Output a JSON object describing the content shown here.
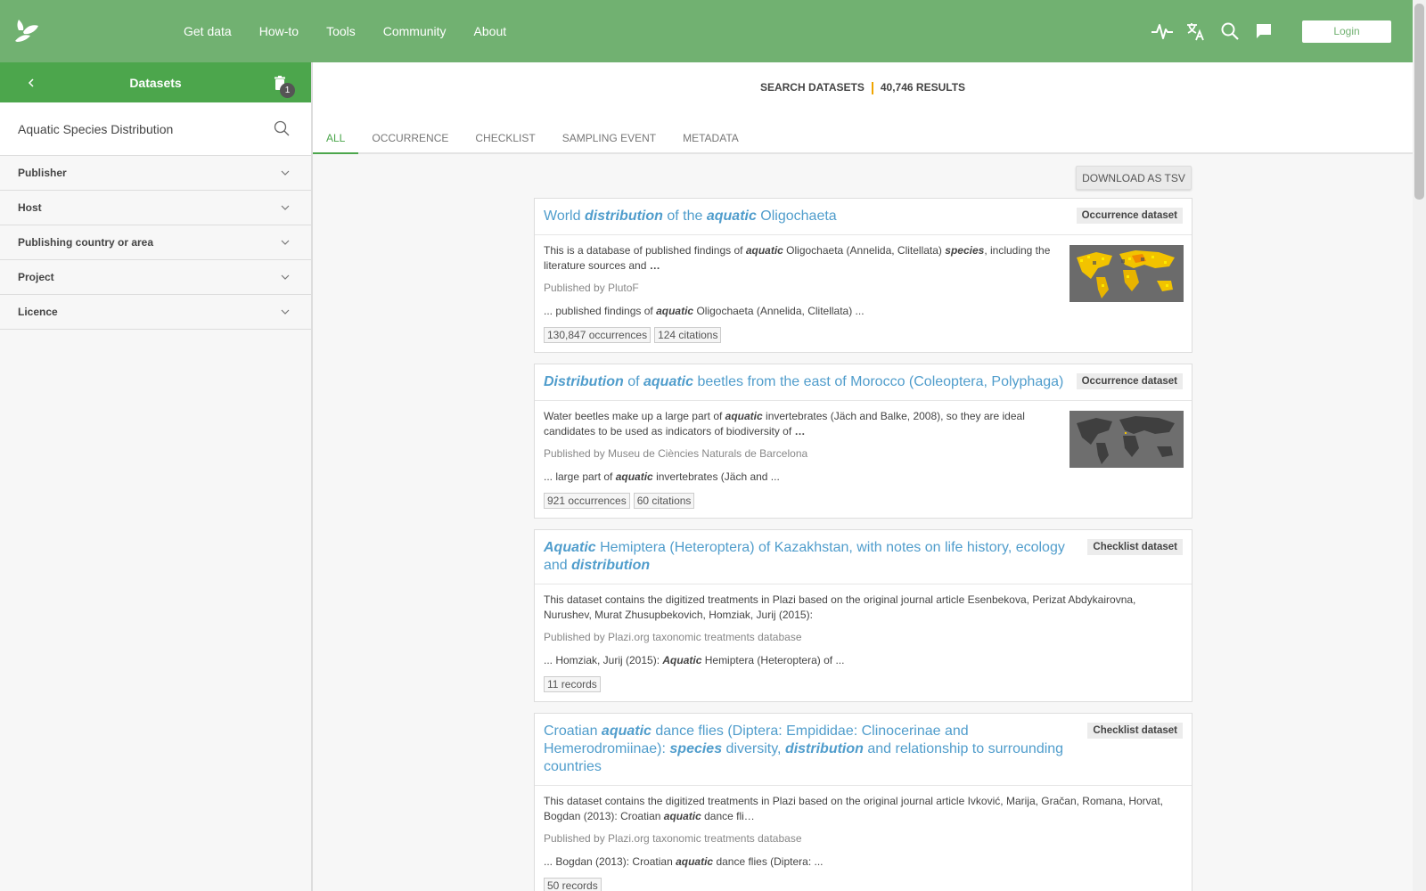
{
  "nav": {
    "items": [
      "Get data",
      "How-to",
      "Tools",
      "Community",
      "About"
    ],
    "login": "Login",
    "icons": [
      "activity-icon",
      "translate-icon",
      "search-icon",
      "feedback-icon"
    ]
  },
  "sidebar": {
    "title": "Datasets",
    "trash_count": "1",
    "search_value": "Aquatic Species Distribution",
    "facets": [
      "Publisher",
      "Host",
      "Publishing country or area",
      "Project",
      "Licence"
    ]
  },
  "main": {
    "summary_label": "SEARCH DATASETS",
    "summary_count": "40,746 RESULTS",
    "tabs": [
      "ALL",
      "OCCURRENCE",
      "CHECKLIST",
      "SAMPLING EVENT",
      "METADATA"
    ],
    "active_tab": "ALL",
    "download_label": "DOWNLOAD AS TSV"
  },
  "results": [
    {
      "title_html": "World <em>distribution</em> of the <em>aquatic</em> Oligochaeta",
      "type": "Occurrence dataset",
      "desc_html": "This is a database of published findings of <i class=\"hl\">aquatic</i> Oligochaeta (Annelida, Clitellata) <i class=\"hl\">species</i>, including the literature sources and <b>…</b>",
      "publisher": "Published by PlutoF",
      "snippet_html": "... published findings of <i class=\"hl\">aquatic</i> Oligochaeta (Annelida, Clitellata) ...",
      "chips": [
        "130,847 occurrences",
        "124 citations"
      ],
      "thumb": "heatmap"
    },
    {
      "title_html": "<em>Distribution</em> of <em>aquatic</em> beetles from the east of Morocco (Coleoptera, Polyphaga)",
      "type": "Occurrence dataset",
      "desc_html": "Water beetles make up a large part of <i class=\"hl\">aquatic</i> invertebrates (Jäch and Balke, 2008), so they are ideal candidates to be used as indicators of biodiversity of <b>…</b>",
      "publisher": "Published by Museu de Ciències Naturals de Barcelona",
      "snippet_html": "... large part of <i class=\"hl\">aquatic</i> invertebrates (Jäch and ...",
      "chips": [
        "921 occurrences",
        "60 citations"
      ],
      "thumb": "worldmap"
    },
    {
      "title_html": "<em>Aquatic</em> Hemiptera (Heteroptera) of Kazakhstan, with notes on life history, ecology and <em>distribution</em>",
      "type": "Checklist dataset",
      "desc_html": "This dataset contains the digitized treatments in Plazi based on the original journal article Esenbekova, Perizat Abdykairovna, Nurushev, Murat Zhusupbekovich, Homziak, Jurij (2015):",
      "publisher": "Published by Plazi.org taxonomic treatments database",
      "snippet_html": "... Homziak, Jurij (2015): <i class=\"hl\">Aquatic</i> Hemiptera (Heteroptera) of ...",
      "chips": [
        "11 records"
      ],
      "thumb": ""
    },
    {
      "title_html": "Croatian <em>aquatic</em> dance flies (Diptera: Empididae: Clinocerinae and Hemerodromiinae): <em>species</em> diversity, <em>distribution</em> and relationship to surrounding countries",
      "type": "Checklist dataset",
      "desc_html": "This dataset contains the digitized treatments in Plazi based on the original journal article Ivković, Marija, Gračan, Romana, Horvat, Bogdan (2013): Croatian <i class=\"hl\">aquatic</i> dance fli…",
      "publisher": "Published by Plazi.org taxonomic treatments database",
      "snippet_html": "... Bogdan (2013): Croatian <i class=\"hl\">aquatic</i> dance flies (Diptera: ...",
      "chips": [
        "50 records"
      ],
      "thumb": ""
    }
  ],
  "colors": {
    "topbar": "#71b171",
    "sidebar_header": "#4ca64c",
    "link": "#509dcc",
    "accent": "#f0a500"
  }
}
